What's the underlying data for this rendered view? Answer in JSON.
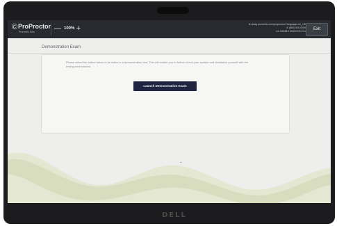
{
  "app": {
    "logo_mark": "©",
    "logo_text": "ProProctor",
    "logo_sub": "Prometric Now"
  },
  "toolbar": {
    "zoom_out_symbol": "—",
    "zoom_level": "100%",
    "zoom_in_symbol": "+",
    "support_url": "study.prometric.com/proproctor/?language=en_US",
    "support_phone": "(800) 000-0000",
    "version": "v.6.1.8038.0 2020/07/21 0.x",
    "exit_label": "Exit"
  },
  "page": {
    "title": "Demonstration Exam",
    "description": "Please select the button below to be taken to a demonstration test. This will enable you to further check your system and familiarize yourself with the testing environment.",
    "launch_label": "Launch Demonstration Exam"
  },
  "device": {
    "brand": "DELL"
  },
  "colors": {
    "toolbar_bg": "#272b30",
    "page_bg": "#eeeeec",
    "button_bg": "#1f2540",
    "wave_light": "#e4e8d2",
    "wave_dark": "#cdd4b2"
  },
  "icons": {
    "support_url_icon": "globe-icon",
    "support_phone_icon": "phone-icon",
    "pointer_icon": "mouse-pointer-icon"
  }
}
